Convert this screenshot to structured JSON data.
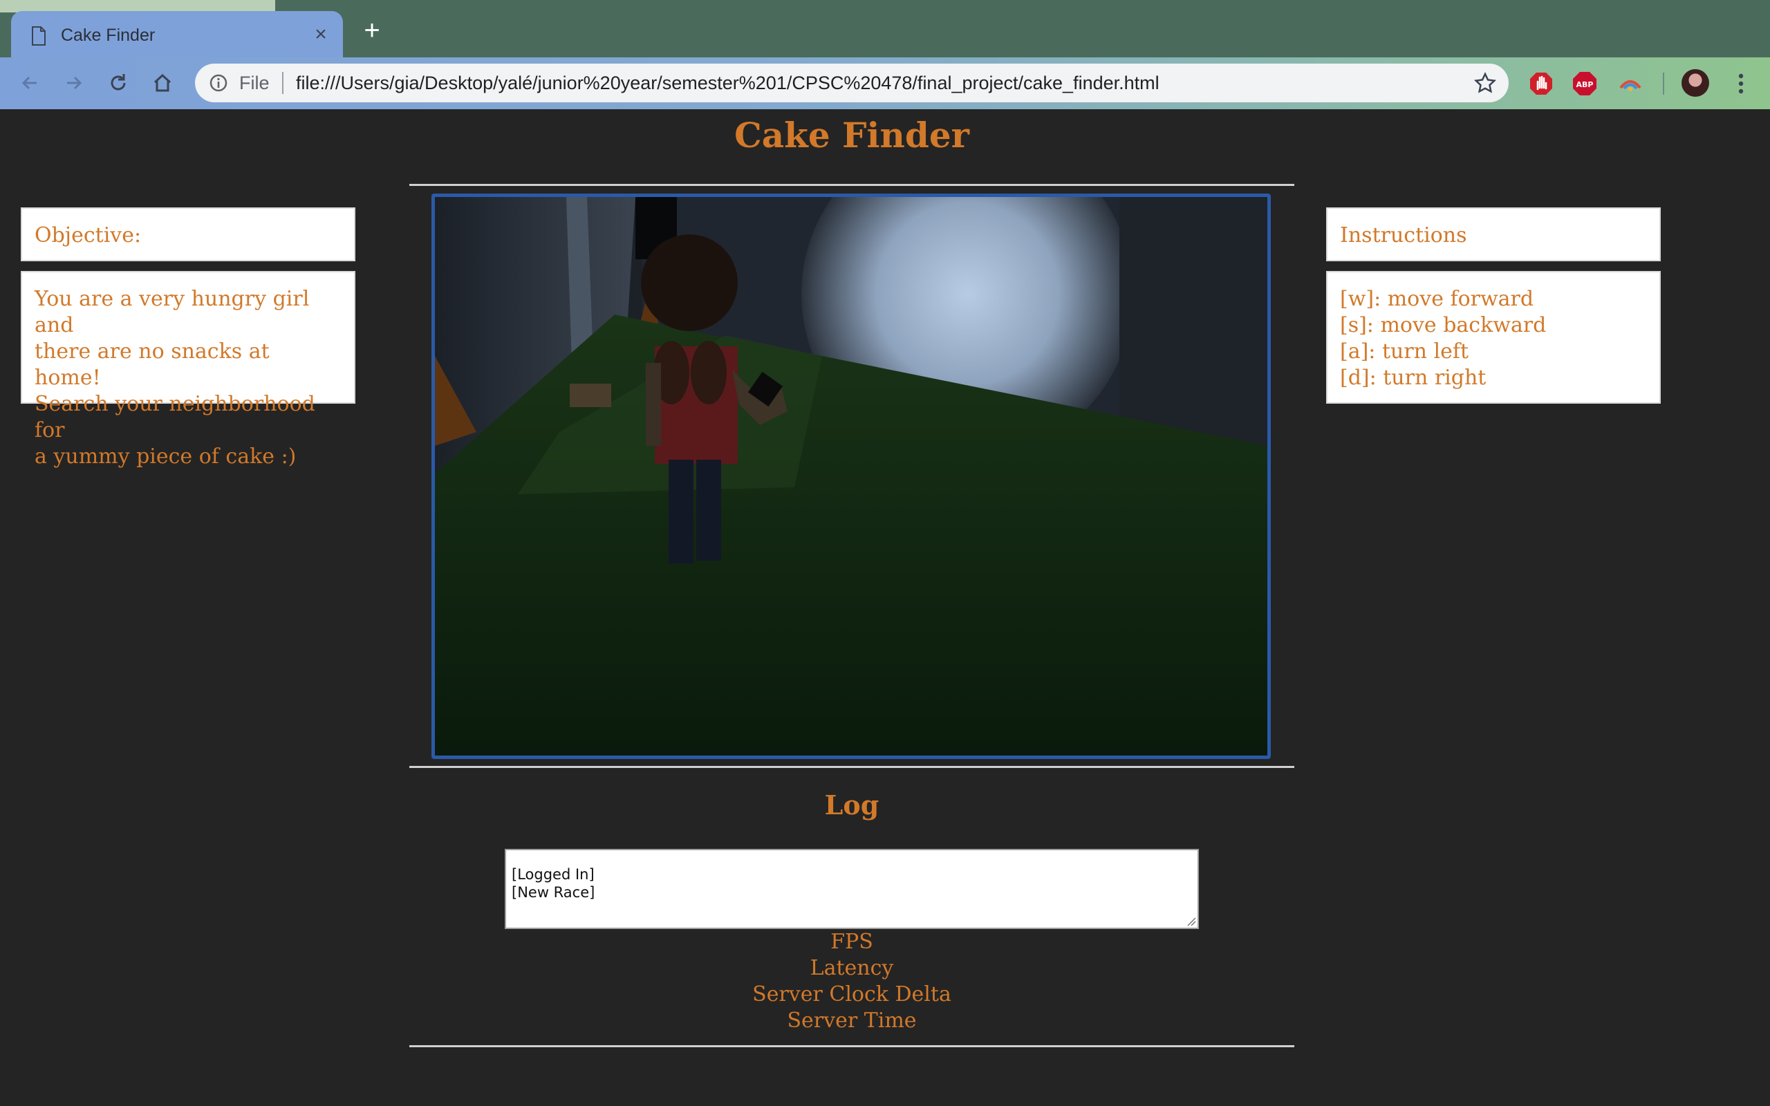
{
  "browser": {
    "tab_title": "Cake Finder",
    "new_tab_label": "+",
    "omnibox_scheme": "File",
    "url": "file:///Users/gia/Desktop/yalé/junior%20year/semester%201/CPSC%20478/final_project/cake_finder.html",
    "extensions": [
      "stop-hand-extension-icon",
      "adblock-plus-icon",
      "rainbow-extension-icon"
    ],
    "ext_abp_text": "ABP"
  },
  "page": {
    "title": "Cake Finder",
    "objective": {
      "heading": "Objective:",
      "lines": [
        "You are a very hungry girl and",
        "there are no snacks at home!",
        "Search your neighborhood for",
        "a yummy piece of cake :)"
      ]
    },
    "instructions": {
      "heading": "Instructions",
      "lines": [
        "[w]: move forward",
        "[s]: move backward",
        "[a]: turn left",
        "[d]: turn right"
      ]
    },
    "log": {
      "heading": "Log",
      "entries": [
        "[Logged In]",
        "[New Race]"
      ]
    },
    "stats": [
      "FPS",
      "Latency",
      "Server Clock Delta",
      "Server Time"
    ]
  },
  "colors": {
    "accent": "#d2792a",
    "page_bg": "#242424",
    "canvas_border": "#2a5aa8"
  }
}
